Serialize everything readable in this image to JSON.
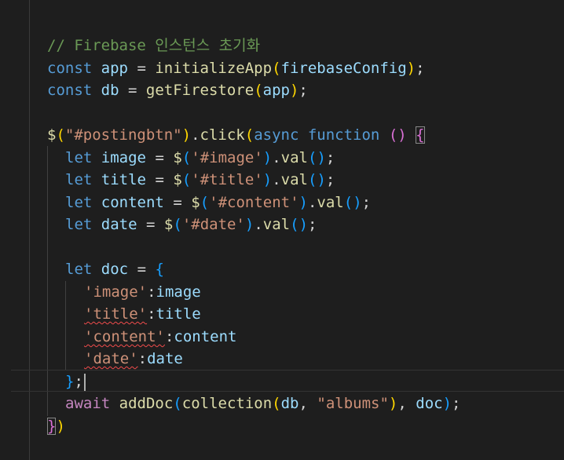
{
  "editor": {
    "comment": "// Firebase 인스턴스 초기화",
    "line2": {
      "kw": "const",
      "name": "app",
      "eq": "=",
      "fn": "initializeApp",
      "open": "(",
      "arg": "firebaseConfig",
      "close": ")",
      "end": ";"
    },
    "line3": {
      "kw": "const",
      "name": "db",
      "eq": "=",
      "fn": "getFirestore",
      "open": "(",
      "arg": "app",
      "close": ")",
      "end": ";"
    },
    "line5": {
      "dollar": "$",
      "open": "(",
      "selector": "\"#postingbtn\"",
      "close": ")",
      "dot": ".",
      "method": "click",
      "open2": "(",
      "async": "async",
      "function": "function",
      "parens": "()",
      "brace": "{"
    },
    "vars": [
      {
        "kw": "let",
        "name": "image",
        "eq": "=",
        "dollar": "$",
        "open": "(",
        "selector": "'#image'",
        "close": ")",
        "dot": ".",
        "method": "val",
        "call": "()",
        "end": ";"
      },
      {
        "kw": "let",
        "name": "title",
        "eq": "=",
        "dollar": "$",
        "open": "(",
        "selector": "'#title'",
        "close": ")",
        "dot": ".",
        "method": "val",
        "call": "()",
        "end": ";"
      },
      {
        "kw": "let",
        "name": "content",
        "eq": "=",
        "dollar": "$",
        "open": "(",
        "selector": "'#content'",
        "close": ")",
        "dot": ".",
        "method": "val",
        "call": "()",
        "end": ";"
      },
      {
        "kw": "let",
        "name": "date",
        "eq": "=",
        "dollar": "$",
        "open": "(",
        "selector": "'#date'",
        "close": ")",
        "dot": ".",
        "method": "val",
        "call": "()",
        "end": ";"
      }
    ],
    "docline": {
      "kw": "let",
      "name": "doc",
      "eq": "=",
      "brace": "{"
    },
    "props": [
      {
        "key": "'image'",
        "colon": ":",
        "value": "image"
      },
      {
        "key": "'title'",
        "colon": ":",
        "value": "title"
      },
      {
        "key": "'content'",
        "colon": ":",
        "value": "content"
      },
      {
        "key": "'date'",
        "colon": ":",
        "value": "date"
      }
    ],
    "closeobj": {
      "brace": "}",
      "end": ";"
    },
    "awaitline": {
      "await": "await",
      "fn": "addDoc",
      "open": "(",
      "fn2": "collection",
      "open2": "(",
      "arg1": "db",
      "comma": ",",
      "str": "\"albums\"",
      "close2": ")",
      "comma2": ",",
      "arg2": "doc",
      "close": ")",
      "end": ";"
    },
    "endline": {
      "brace": "}",
      "paren": ")"
    }
  },
  "colors": {
    "background": "#1e1e1e",
    "keyword": "#569cd6",
    "control": "#c586c0",
    "variable": "#9cdcfe",
    "function": "#dcdcaa",
    "string": "#ce9178",
    "comment": "#6a9955",
    "bracket1": "#ffd700",
    "bracket2": "#da70d6",
    "bracket3": "#179fff",
    "error": "#f14c4c"
  }
}
